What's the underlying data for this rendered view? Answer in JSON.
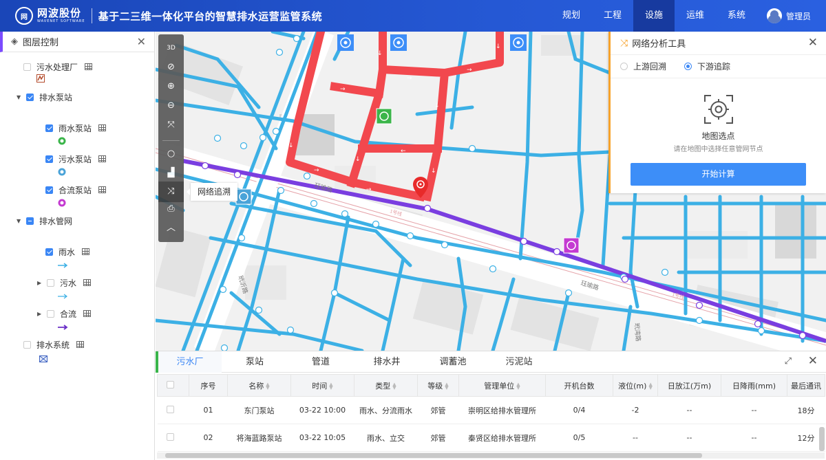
{
  "header": {
    "logo_mark": "网",
    "logo_cn": "网波股份",
    "logo_en": "WAVENET SOFTWARE",
    "title": "基于二三维一体化平台的智慧排水运营监管系统",
    "nav": [
      "规划",
      "工程",
      "设施",
      "运维",
      "系统"
    ],
    "active_nav": "设施",
    "user": "管理员"
  },
  "sidebar": {
    "title": "图层控制",
    "items": [
      {
        "label": "污水处理厂",
        "checked": false
      },
      {
        "label": "排水泵站",
        "checked": true
      },
      {
        "label": "雨水泵站",
        "checked": true
      },
      {
        "label": "污水泵站",
        "checked": true
      },
      {
        "label": "合流泵站",
        "checked": true
      },
      {
        "label": "排水管网",
        "checked": "partial"
      },
      {
        "label": "雨水",
        "checked": true
      },
      {
        "label": "污水",
        "checked": false
      },
      {
        "label": "合流",
        "checked": false
      },
      {
        "label": "排水系统",
        "checked": false
      }
    ]
  },
  "map": {
    "tooltip": "网络追溯",
    "road_labels": [
      "珏瑜路",
      "珏瑜路",
      "玳沂路",
      "玳湾路",
      "1号线",
      "1号线"
    ]
  },
  "panel": {
    "title": "网络分析工具",
    "radio_options": [
      "上游回溯",
      "下游追踪"
    ],
    "selected_radio": "下游追踪",
    "pick_title": "地图选点",
    "pick_hint": "请在地图中选择任意管网节点",
    "button": "开始计算"
  },
  "bottom": {
    "tabs": [
      "污水厂",
      "泵站",
      "管道",
      "排水井",
      "调蓄池",
      "污泥站"
    ],
    "active_tab": "污水厂",
    "columns": [
      "序号",
      "名称",
      "时间",
      "类型",
      "等级",
      "管理单位",
      "开机台数",
      "液位(m)",
      "日放江(万m)",
      "日降雨(mm)",
      "最后通讯"
    ],
    "rows": [
      [
        "01",
        "东门泵站",
        "03-22 10:00",
        "雨水、分流雨水",
        "郊管",
        "崇明区给排水管理所",
        "0/4",
        "-2",
        "--",
        "--",
        "18分"
      ],
      [
        "02",
        "将海蓝路泵站",
        "03-22 10:05",
        "雨水、立交",
        "郊管",
        "秦贤区给排水管理所",
        "0/5",
        "--",
        "--",
        "--",
        "12分"
      ]
    ]
  },
  "colors": {
    "primary": "#2558d4",
    "accent": "#3a86f5",
    "trace": "#f2484e",
    "pipe_rain": "#3cb0e5",
    "pipe_combined": "#7a3ee0"
  }
}
